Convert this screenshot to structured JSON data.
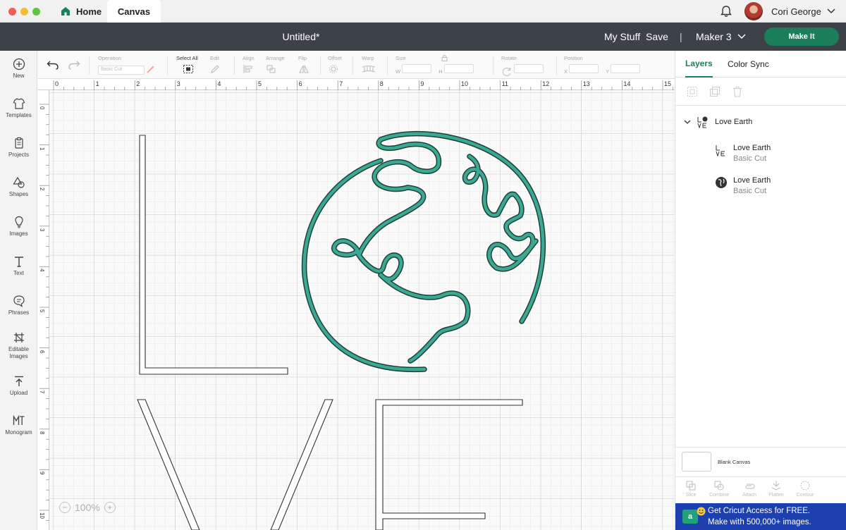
{
  "window": {
    "tabs": [
      {
        "label": "Home"
      },
      {
        "label": "Canvas"
      }
    ],
    "user": {
      "name": "Cori George"
    }
  },
  "header": {
    "title": "Untitled*",
    "my_stuff": "My Stuff",
    "save": "Save",
    "separator": "|",
    "machine": "Maker 3",
    "make_it": "Make It"
  },
  "sidebar": {
    "items": [
      {
        "label": "New",
        "icon": "plus-circle-icon"
      },
      {
        "label": "Templates",
        "icon": "shirt-icon"
      },
      {
        "label": "Projects",
        "icon": "clipboard-icon"
      },
      {
        "label": "Shapes",
        "icon": "shapes-icon"
      },
      {
        "label": "Images",
        "icon": "lightbulb-icon"
      },
      {
        "label": "Text",
        "icon": "text-icon"
      },
      {
        "label": "Phrases",
        "icon": "speech-bubble-icon"
      },
      {
        "label": "Editable Images",
        "icon": "editable-image-icon"
      },
      {
        "label": "Upload",
        "icon": "upload-icon"
      },
      {
        "label": "Monogram",
        "icon": "monogram-icon"
      }
    ]
  },
  "toolbar": {
    "operation_label": "Operation",
    "operation_value": "Basic Cut",
    "select_all": "Select All",
    "edit": "Edit",
    "align": "Align",
    "arrange": "Arrange",
    "flip": "Flip",
    "offset": "Offset",
    "warp": "Warp",
    "size": "Size",
    "w": "W",
    "h": "H",
    "rotate": "Rotate",
    "position": "Position",
    "x": "X",
    "y": "Y"
  },
  "canvas": {
    "ruler_top": [
      "0",
      "1",
      "2",
      "3",
      "4",
      "5",
      "6",
      "7",
      "8",
      "9",
      "10",
      "11",
      "12",
      "13",
      "14",
      "15"
    ],
    "ruler_left": [
      "0",
      "1",
      "2",
      "3",
      "4",
      "5",
      "6",
      "7",
      "8",
      "9",
      "10"
    ],
    "zoom": "100%",
    "design_color": "#3aa893"
  },
  "right_panel": {
    "tabs": [
      {
        "label": "Layers",
        "active": true
      },
      {
        "label": "Color Sync",
        "active": false
      }
    ],
    "layer_group": {
      "name": "Love Earth"
    },
    "layers": [
      {
        "name": "Love Earth",
        "operation": "Basic Cut"
      },
      {
        "name": "Love Earth",
        "operation": "Basic Cut"
      }
    ],
    "blank_canvas": "Blank Canvas",
    "tools": [
      "Slice",
      "Combine",
      "Attach",
      "Flatten",
      "Contour"
    ],
    "promo": {
      "badge": "a",
      "line1": "Get Cricut Access for FREE.",
      "line2": "Make with 500,000+ images."
    },
    "accent_color": "#1b7f5b"
  }
}
